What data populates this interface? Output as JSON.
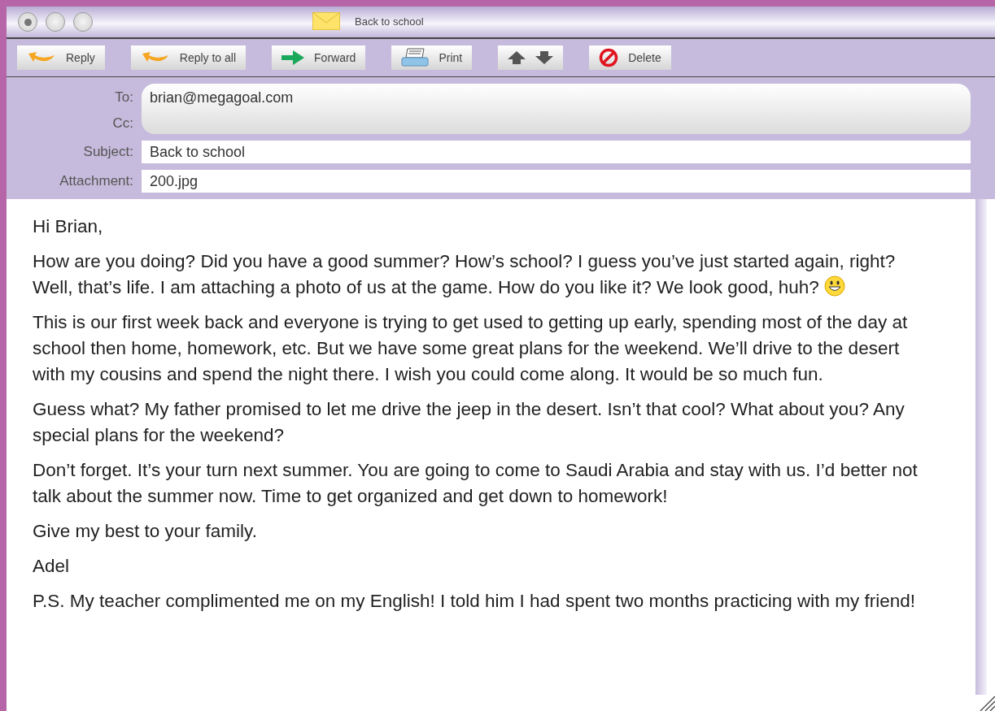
{
  "window": {
    "title": "Back to school"
  },
  "toolbar": [
    {
      "kind": "reply",
      "label": "Reply"
    },
    {
      "kind": "reply",
      "label": "Reply to all"
    },
    {
      "kind": "forward",
      "label": "Forward"
    },
    {
      "kind": "print",
      "label": "Print"
    },
    {
      "kind": "updown"
    },
    {
      "kind": "delete",
      "label": "Delete"
    }
  ],
  "header": {
    "to_label": "To:",
    "to": "brian@megagoal.com",
    "cc_label": "Cc:",
    "subject_label": "Subject:",
    "subject": "Back to school",
    "attachment_label": "Attachment:",
    "attachment": "200.jpg"
  },
  "body": [
    {
      "text": "Hi Brian,"
    },
    {
      "text": "How are you doing? Did you have a good summer? How’s school? I guess you’ve just started again, right? Well, that’s life. I am attaching a photo of us at the game. How do you like it? We look good, huh?",
      "smiley": true
    },
    {
      "text": "This is our first week back and everyone is trying to get used to getting up early, spending most of the day at school then home, homework, etc. But we have some great plans for the weekend. We’ll drive to the desert with my cousins and spend the night there. I wish you could come along. It would be so much fun."
    },
    {
      "text": "Guess what? My father promised to let me drive the jeep in the desert. Isn’t that cool? What about you? Any special plans for the weekend?"
    },
    {
      "text": "Don’t forget. It’s your turn next summer. You are going to come to Saudi Arabia and stay with us. I’d better not talk about the summer now. Time to get organized and get down to homework!"
    },
    {
      "text": "Give my best to your family."
    },
    {
      "text": "Adel"
    },
    {
      "text": "P.S. My teacher complimented me on my English! I told him I had spent two months practicing with my friend!"
    }
  ]
}
